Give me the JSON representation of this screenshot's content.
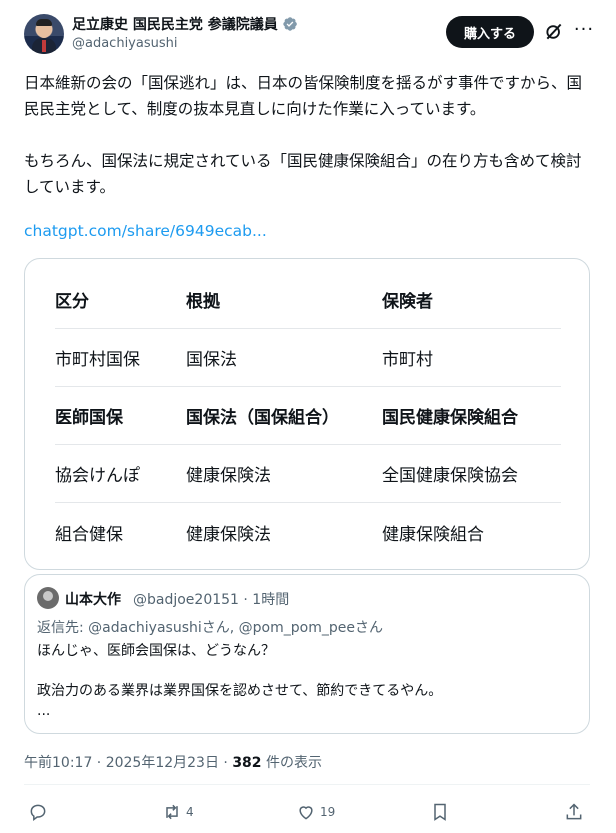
{
  "author": {
    "name": "足立康史 国民民主党 参議院議員",
    "handle": "@adachiyasushi",
    "buy_label": "購入する"
  },
  "tweet": {
    "paragraph1": "日本維新の会の「国保逃れ」は、日本の皆保険制度を揺るがす事件ですから、国民民主党として、制度の抜本見直しに向けた作業に入っています。",
    "paragraph2": "もちろん、国保法に規定されている「国民健康保険組合」の在り方も含めて検討しています。",
    "link": "chatgpt.com/share/6949ecab..."
  },
  "table": {
    "headers": [
      "区分",
      "根拠",
      "保険者"
    ],
    "rows": [
      [
        "市町村国保",
        "国保法",
        "市町村"
      ],
      [
        "医師国保",
        "国保法（国保組合）",
        "国民健康保険組合"
      ],
      [
        "協会けんぽ",
        "健康保険法",
        "全国健康保険協会"
      ],
      [
        "組合健保",
        "健康保険法",
        "健康保険組合"
      ]
    ]
  },
  "quote": {
    "name": "山本大作",
    "meta": "@badjoe20151 · 1時間",
    "reply_prefix": "返信先: ",
    "reply_mention1": "@adachiyasushiさん",
    "reply_sep": ", ",
    "reply_mention2": "@pom_pom_peeさん",
    "line1": "ほんじゃ、医師会国保は、どうなん？",
    "line2": "政治力のある業界は業界国保を認めさせて、節約できてるやん。",
    "line3": "..."
  },
  "meta": {
    "time": "午前10:17 · 2025年12月23日 · ",
    "views": "382",
    "views_label": " 件の表示"
  },
  "actions": {
    "reposts": "4",
    "likes": "19"
  },
  "icons": {
    "verified": "verified-badge-icon",
    "grok": "grok-icon",
    "more": "more-icon",
    "reply": "reply-icon",
    "repost": "repost-icon",
    "like": "like-icon",
    "bookmark": "bookmark-icon",
    "share": "share-icon"
  }
}
